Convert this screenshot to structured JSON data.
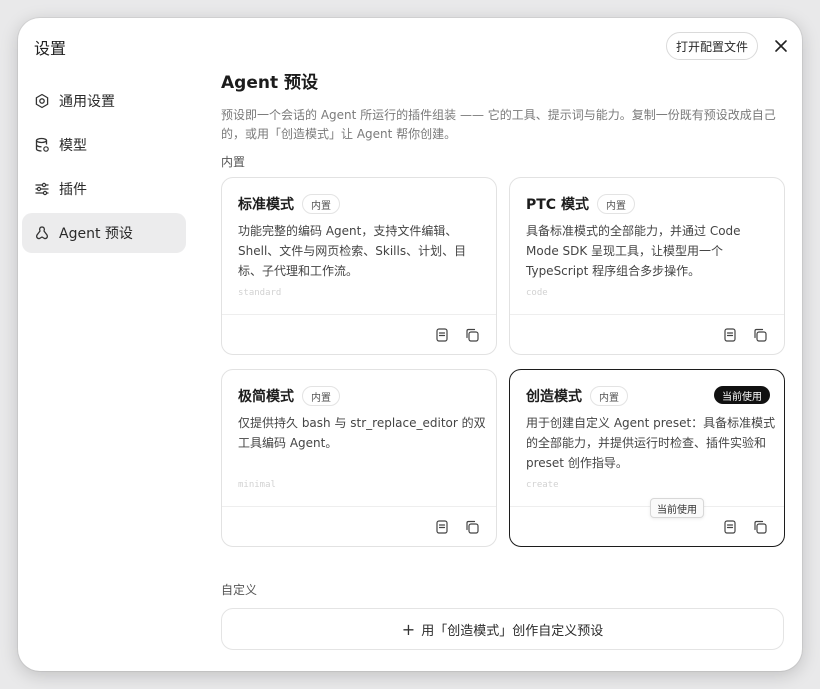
{
  "window": {
    "title": "设置"
  },
  "header": {
    "open_config_label": "打开配置文件"
  },
  "sidebar": {
    "items": [
      {
        "label": "通用设置",
        "icon": "gear-icon"
      },
      {
        "label": "模型",
        "icon": "database-icon"
      },
      {
        "label": "插件",
        "icon": "sliders-icon"
      },
      {
        "label": "Agent 预设",
        "icon": "agent-icon",
        "active": true
      }
    ]
  },
  "main": {
    "title": "Agent 预设",
    "description": "预设即一个会话的 Agent 所运行的插件组装 —— 它的工具、提示词与能力。复制一份既有预设改成自己的，或用「创造模式」让 Agent 帮你创建。",
    "builtin_label": "内置",
    "custom_label": "自定义",
    "create_button": "用「创造模式」创作自定义预设",
    "tooltip": "当前使用"
  },
  "presets": [
    {
      "title": "标准模式",
      "badge": "内置",
      "description": "功能完整的编码 Agent，支持文件编辑、Shell、文件与网页检索、Skills、计划、目标、子代理和工作流。",
      "id": "standard",
      "current": false
    },
    {
      "title": "PTC 模式",
      "badge": "内置",
      "description": "具备标准模式的全部能力，并通过 Code Mode SDK 呈现工具，让模型用一个 TypeScript 程序组合多步操作。",
      "id": "code",
      "current": false
    },
    {
      "title": "极简模式",
      "badge": "内置",
      "description": "仅提供持久 bash 与 str_replace_editor 的双工具编码 Agent。",
      "id": "minimal",
      "current": false
    },
    {
      "title": "创造模式",
      "badge": "内置",
      "description": "用于创建自定义 Agent preset：具备标准模式的全部能力，并提供运行时检查、插件实验和 preset 创作指导。",
      "id": "create",
      "current": true,
      "current_label": "当前使用"
    }
  ]
}
